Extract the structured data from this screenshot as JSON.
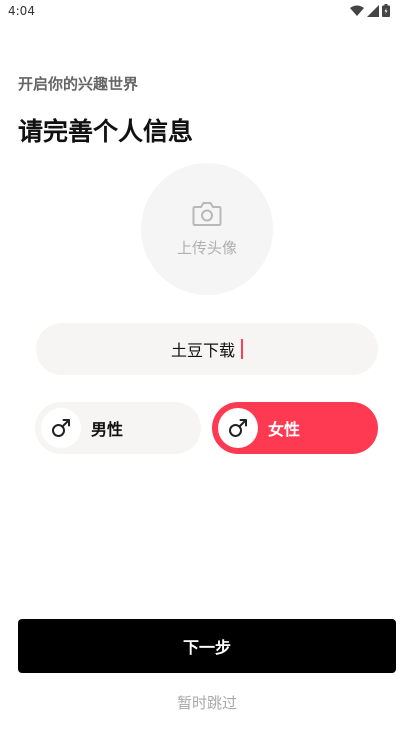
{
  "status_bar": {
    "time": "4:04",
    "icons": [
      "wifi-icon",
      "signal-icon",
      "battery-icon"
    ]
  },
  "header": {
    "subtitle": "开启你的兴趣世界",
    "title": "请完善个人信息"
  },
  "avatar": {
    "label": "上传头像",
    "icon": "camera-icon"
  },
  "nickname": {
    "value": "土豆下载"
  },
  "gender": {
    "options": [
      {
        "label": "男性",
        "icon": "male-icon",
        "selected": false
      },
      {
        "label": "女性",
        "icon": "male-icon",
        "selected": true
      }
    ]
  },
  "actions": {
    "next_label": "下一步",
    "skip_label": "暂时跳过"
  },
  "colors": {
    "accent": "#fe3a52",
    "field_bg": "#f6f5f3",
    "primary_button": "#000000"
  }
}
